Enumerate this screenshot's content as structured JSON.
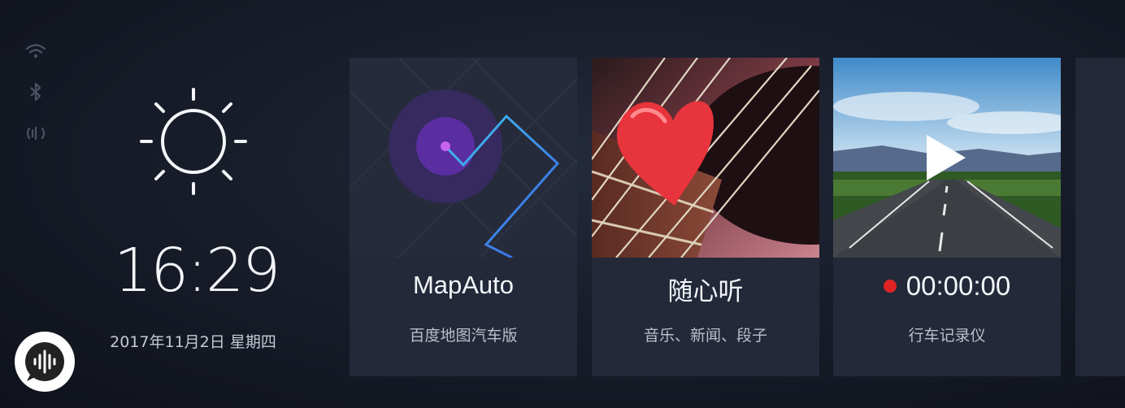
{
  "status": {
    "icons": [
      "wifi-icon",
      "bluetooth-icon",
      "signal-icon"
    ]
  },
  "weather": {
    "icon": "sun-icon"
  },
  "clock": {
    "time": "16:29",
    "date": "2017年11月2日 星期四"
  },
  "voice": {
    "icon": "voice-assistant-icon"
  },
  "cards": [
    {
      "title": "MapAuto",
      "subtitle": "百度地图汽车版"
    },
    {
      "title": "随心听",
      "subtitle": "音乐、新闻、段子"
    },
    {
      "time": "00:00:00",
      "subtitle": "行车记录仪",
      "record_color": "#e02424"
    }
  ],
  "colors": {
    "accent_cyan": "#3fc4ea",
    "accent_purple": "#9b3fd8",
    "record_red": "#e02424"
  }
}
